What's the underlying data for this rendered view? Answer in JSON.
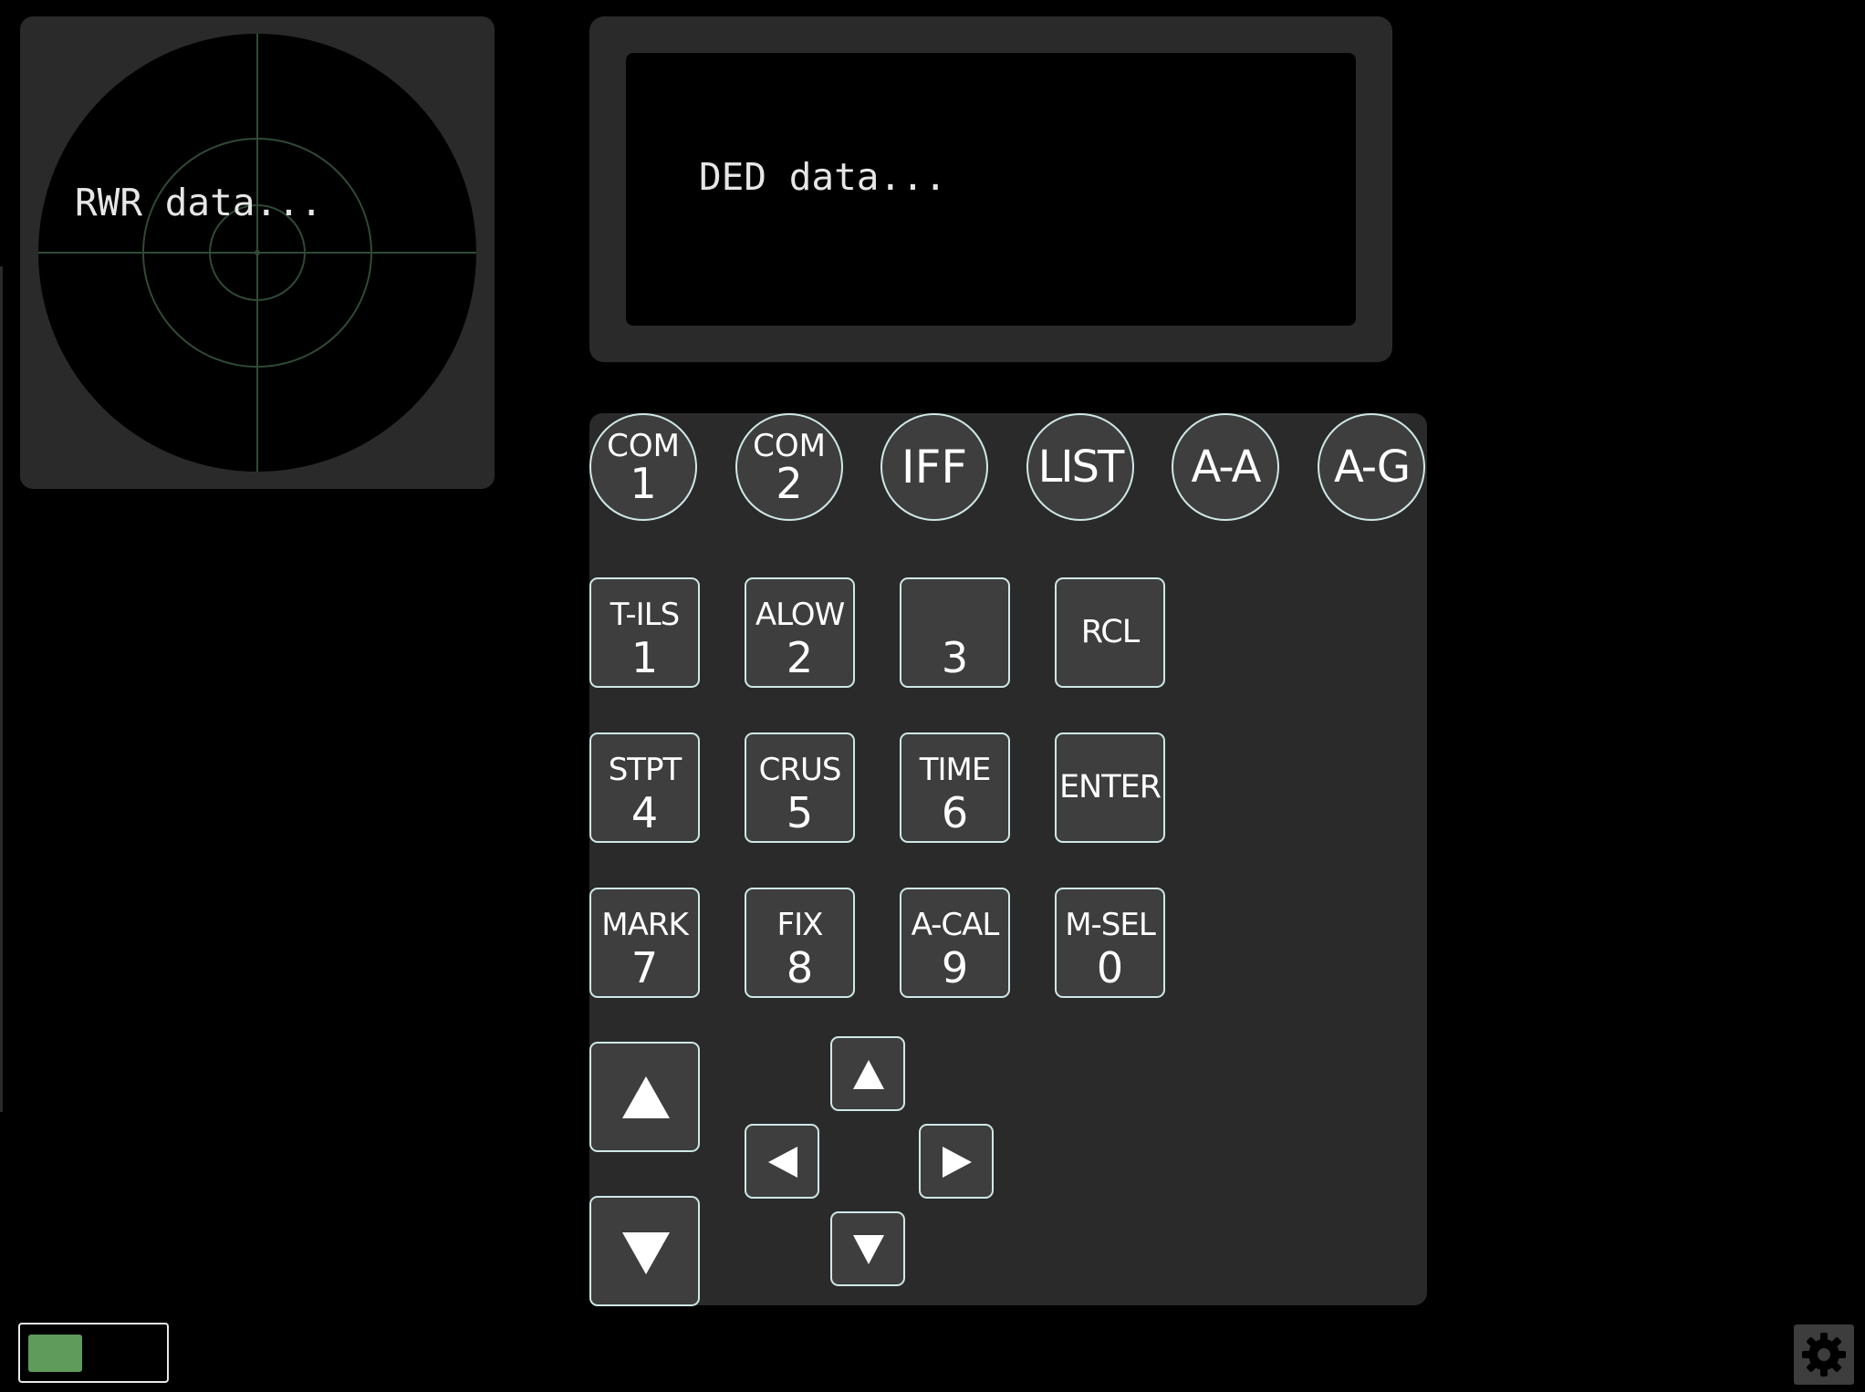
{
  "rwr": {
    "text": "RWR data..."
  },
  "ded": {
    "text": "DED data..."
  },
  "function_keys": [
    {
      "top": "COM",
      "bottom": "1"
    },
    {
      "top": "COM",
      "bottom": "2"
    },
    {
      "label": "IFF"
    },
    {
      "label": "LIST"
    },
    {
      "label": "A-A"
    },
    {
      "label": "A-G"
    }
  ],
  "keypad": {
    "row1": [
      {
        "top": "T-ILS",
        "bottom": "1"
      },
      {
        "top": "ALOW",
        "bottom": "2"
      },
      {
        "top": "",
        "bottom": "3"
      },
      {
        "label": "RCL"
      }
    ],
    "row2": [
      {
        "top": "STPT",
        "bottom": "4"
      },
      {
        "top": "CRUS",
        "bottom": "5"
      },
      {
        "top": "TIME",
        "bottom": "6"
      },
      {
        "label": "ENTER"
      }
    ],
    "row3": [
      {
        "top": "MARK",
        "bottom": "7"
      },
      {
        "top": "FIX",
        "bottom": "8"
      },
      {
        "top": "A-CAL",
        "bottom": "9"
      },
      {
        "top": "M-SEL",
        "bottom": "0"
      }
    ]
  },
  "arrows": {
    "increment": "up-triangle-icon",
    "decrement": "down-triangle-icon",
    "dobber_up": "up-triangle-icon",
    "dobber_down": "down-triangle-icon",
    "dobber_left": "left-triangle-icon",
    "dobber_right": "right-triangle-icon"
  },
  "toggle": {
    "state": "on",
    "color": "#5f9b5b"
  },
  "settings": {
    "icon": "gear-icon"
  },
  "colors": {
    "background": "#000000",
    "panel": "#2a2a2b",
    "button": "#3e3e3f",
    "button_border": "#cfe8e6",
    "rwr_grid": "#2f4a36",
    "text": "#e6e6e6"
  }
}
